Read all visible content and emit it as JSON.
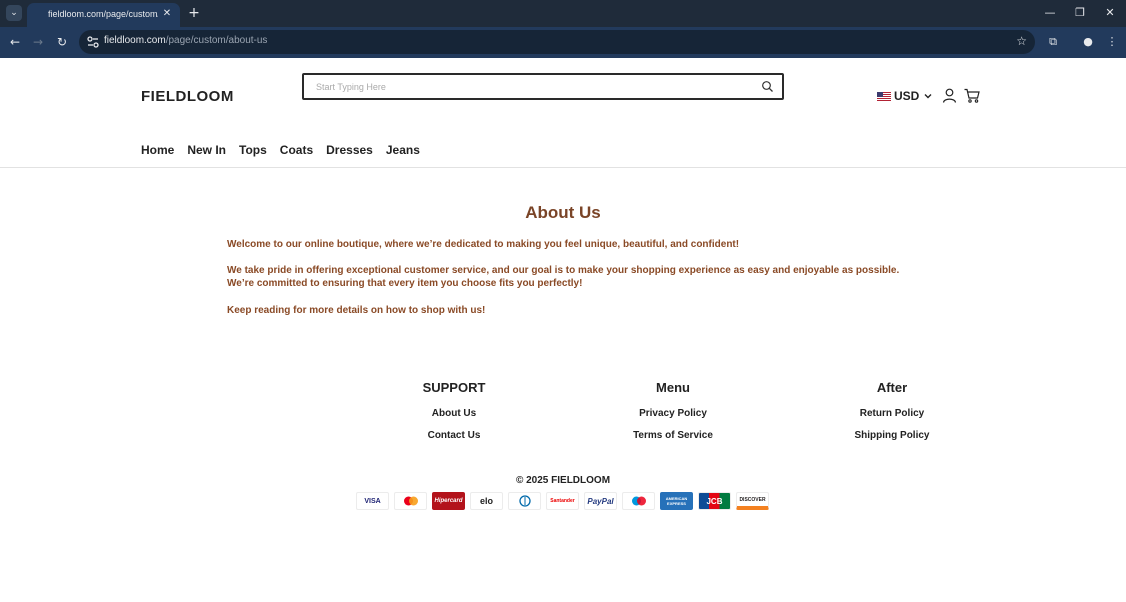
{
  "browser": {
    "tab_title": "fieldloom.com/page/custom/about-us",
    "url_domain": "fieldloom.com",
    "url_path": "/page/custom/about-us"
  },
  "header": {
    "logo": "FIELDLOOM",
    "search_placeholder": "Start Typing Here",
    "currency": "USD"
  },
  "nav": {
    "items": [
      "Home",
      "New In",
      "Tops",
      "Coats",
      "Dresses",
      "Jeans"
    ]
  },
  "about": {
    "title": "About Us",
    "p1": "Welcome to our online boutique, where we’re dedicated to making you feel unique, beautiful, and confident!",
    "p2_line1": "We take pride in offering exceptional customer service, and our goal is to make your shopping experience as easy and enjoyable as possible.",
    "p2_line2": "We’re committed to ensuring that every item you choose fits you perfectly!",
    "p3": "Keep reading for more details on how to shop with us!"
  },
  "footer": {
    "columns": [
      {
        "heading": "SUPPORT",
        "links": [
          "About Us",
          "Contact Us"
        ]
      },
      {
        "heading": "Menu",
        "links": [
          "Privacy Policy",
          "Terms of Service"
        ]
      },
      {
        "heading": "After",
        "links": [
          "Return Policy",
          "Shipping Policy"
        ]
      }
    ],
    "copyright": "© 2025 FIELDLOOM",
    "payment_methods": [
      {
        "name": "visa",
        "label": "VISA"
      },
      {
        "name": "mastercard",
        "label": ""
      },
      {
        "name": "hipercard",
        "label": "Hipercard"
      },
      {
        "name": "elo",
        "label": "elo"
      },
      {
        "name": "diners-club",
        "label": ""
      },
      {
        "name": "santander",
        "label": "Santander"
      },
      {
        "name": "paypal",
        "label": "PayPal"
      },
      {
        "name": "maestro",
        "label": ""
      },
      {
        "name": "american-express",
        "label": "AMERICAN EXPRESS"
      },
      {
        "name": "jcb",
        "label": "JCB"
      },
      {
        "name": "discover",
        "label": "DISCOVER"
      }
    ]
  },
  "colors": {
    "accent_brown": "#8a4a26",
    "title_brown": "#7a4427",
    "chrome_dark": "#1f2b3a",
    "chrome_toolbar": "#223a5c"
  }
}
